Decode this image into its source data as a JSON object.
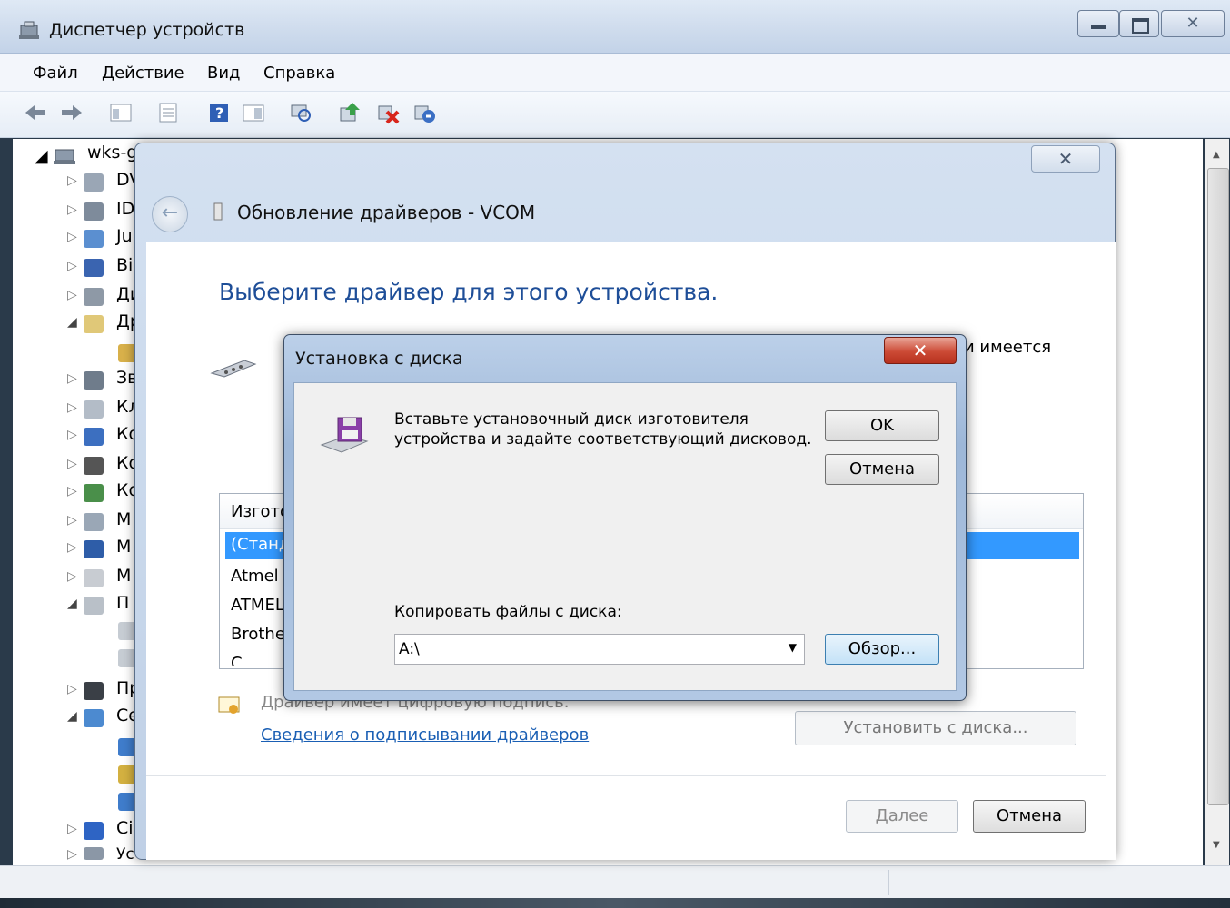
{
  "window": {
    "title": "Диспетчер устройств"
  },
  "menu": [
    "Файл",
    "Действие",
    "Вид",
    "Справка"
  ],
  "toolbar_icons": [
    "back-icon",
    "forward-icon",
    "console-tree-icon",
    "properties-icon",
    "help-icon",
    "view-icon",
    "scan-hardware-icon",
    "update-driver-icon",
    "uninstall-icon",
    "disable-icon"
  ],
  "tree": {
    "root": "wks-g",
    "items": [
      "DV",
      "ID",
      "Ju",
      "Ві",
      "Ди",
      "Др",
      "Зв",
      "Кл",
      "Ко",
      "Ко",
      "Ко",
      "М",
      "М",
      "М",
      "П",
      "Пр",
      "Се",
      "Сі",
      "Ус"
    ]
  },
  "wizard": {
    "title": "Обновление драйверов - VCOM",
    "heading": "Выберите драйвер для этого устройства.",
    "right_text": "и имеется",
    "table_header": "Изготов",
    "rows": [
      "(Станда",
      "Atmel C",
      "ATMEL,",
      "Brother",
      "C..."
    ],
    "signed_text": "Драйвер имеет цифровую подпись.",
    "signing_link": "Сведения о подписывании драйверов",
    "install_from_disk": "Установить с диска...",
    "next": "Далее",
    "cancel": "Отмена"
  },
  "disk_dialog": {
    "title": "Установка с диска",
    "message_line1": "Вставьте установочный диск изготовителя",
    "message_line2": "устройства и задайте соответствующий дисковод.",
    "ok": "OK",
    "cancel": "Отмена",
    "copy_label": "Копировать файлы с диска:",
    "path": "A:\\",
    "browse": "Обзор..."
  }
}
